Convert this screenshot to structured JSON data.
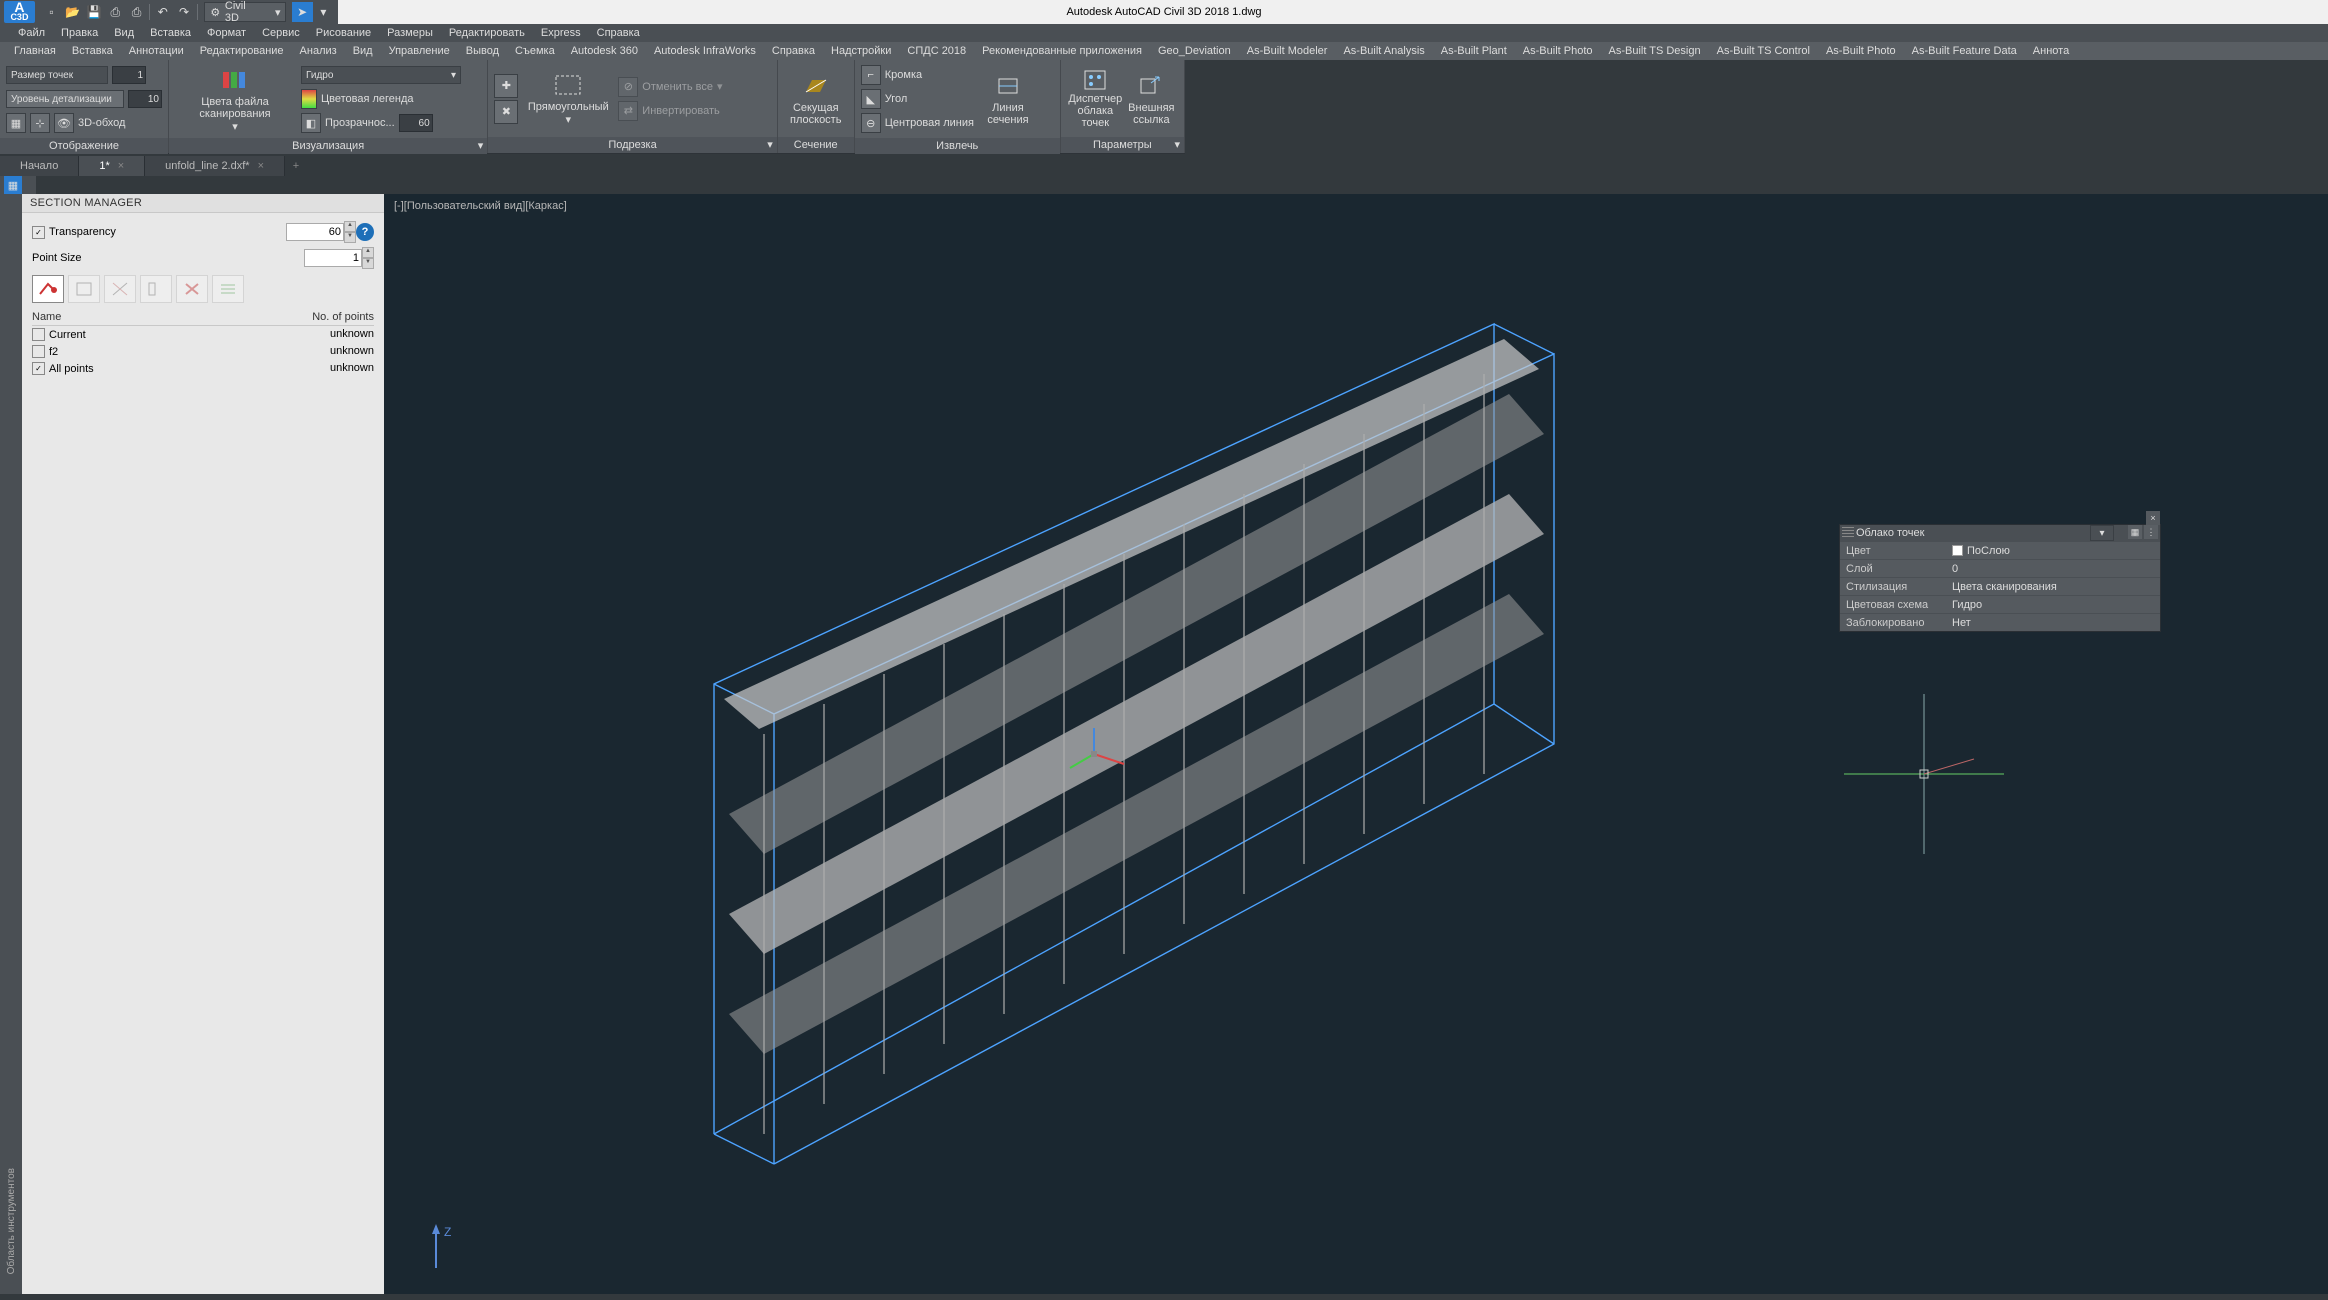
{
  "app": {
    "title": "Autodesk AutoCAD Civil 3D 2018   1.dwg",
    "workspace": "Civil 3D"
  },
  "qat_icons": [
    "new",
    "open",
    "save",
    "saveas",
    "print",
    "undo",
    "redo"
  ],
  "menus": [
    "Файл",
    "Правка",
    "Вид",
    "Вставка",
    "Формат",
    "Сервис",
    "Рисование",
    "Размеры",
    "Редактировать",
    "Express",
    "Справка"
  ],
  "tabs": [
    "Главная",
    "Вставка",
    "Аннотации",
    "Редактирование",
    "Анализ",
    "Вид",
    "Управление",
    "Вывод",
    "Съемка",
    "Autodesk 360",
    "Autodesk InfraWorks",
    "Справка",
    "Надстройки",
    "СПДС 2018",
    "Рекомендованные приложения",
    "Geo_Deviation",
    "As-Built Modeler",
    "As-Built Analysis",
    "As-Built Plant",
    "As-Built Photo",
    "As-Built TS Design",
    "As-Built TS Control",
    "As-Built Photo",
    "As-Built Feature Data",
    "Аннота"
  ],
  "ribbon": {
    "p1": {
      "title": "Отображение",
      "size_label": "Размер точек",
      "size_val": "1",
      "detail_label": "Уровень детализации",
      "detail_val": "10",
      "walk_label": "3D-обход"
    },
    "p2": {
      "title": "Визуализация",
      "big_label": "Цвета файла сканирования",
      "combo_label": "Гидро",
      "legend_label": "Цветовая легенда",
      "trans_label": "Прозрачнос...",
      "trans_val": "60"
    },
    "p3": {
      "title": "Подрезка",
      "rect_label": "Прямоугольный",
      "cancel_label": "Отменить все",
      "invert_label": "Инвертировать"
    },
    "p4": {
      "title": "Сечение",
      "plane_label1": "Секущая",
      "plane_label2": "плоскость"
    },
    "p5": {
      "title": "Извлечь",
      "edge_label": "Кромка",
      "corner_label": "Угол",
      "center_label": "Центровая линия",
      "sec_label1": "Линия",
      "sec_label2": "сечения"
    },
    "p6": {
      "title": "Параметры",
      "disp_label1": "Диспетчер",
      "disp_label2": "облака точек",
      "ext_label1": "Внешняя",
      "ext_label2": "ссылка"
    }
  },
  "file_tabs": {
    "t1": "Начало",
    "t2": "1*",
    "t3": "unfold_line 2.dxf*"
  },
  "viewport_label": "[-][Пользовательский вид][Каркас]",
  "section_mgr": {
    "title": "SECTION MANAGER",
    "transparency_label": "Transparency",
    "transparency_val": "60",
    "pointsize_label": "Point Size",
    "pointsize_val": "1",
    "th_name": "Name",
    "th_pts": "No. of points",
    "rows": [
      {
        "chk": false,
        "name": "Current",
        "pts": "unknown"
      },
      {
        "chk": false,
        "name": "f2",
        "pts": "unknown"
      },
      {
        "chk": true,
        "name": "All points",
        "pts": "unknown"
      }
    ]
  },
  "palette": {
    "title": "Облако точек",
    "rows": [
      {
        "k": "Цвет",
        "v": "ПоСлою",
        "sw": true
      },
      {
        "k": "Слой",
        "v": "0"
      },
      {
        "k": "Стилизация",
        "v": "Цвета сканирования"
      },
      {
        "k": "Цветовая схема",
        "v": "Гидро"
      },
      {
        "k": "Заблокировано",
        "v": "Нет"
      }
    ]
  },
  "side_rail": "Область инструментов",
  "z_label": "Z"
}
